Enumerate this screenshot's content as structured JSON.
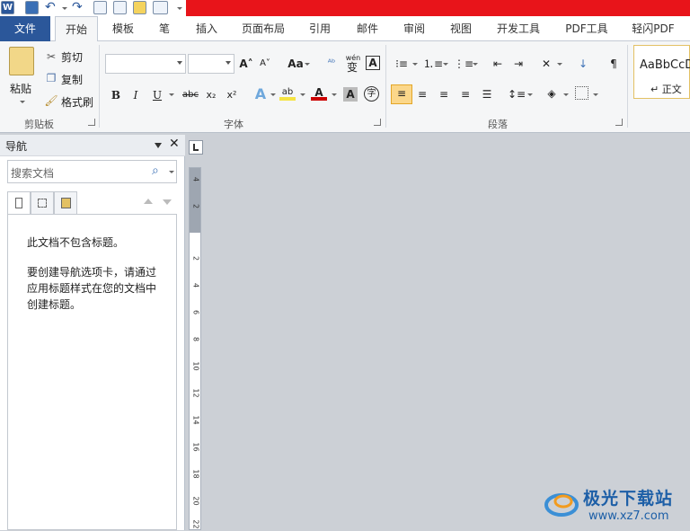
{
  "tabs": [
    "文件",
    "开始",
    "模板",
    "笔",
    "插入",
    "页面布局",
    "引用",
    "邮件",
    "审阅",
    "视图",
    "开发工具",
    "PDF工具",
    "轻闪PDF"
  ],
  "clipboard": {
    "paste": "粘贴",
    "cut": "剪切",
    "copy": "复制",
    "format_painter": "格式刷",
    "group": "剪贴板"
  },
  "font": {
    "group": "字体",
    "aa": "Aa",
    "bold": "B",
    "italic": "I",
    "underline": "U",
    "strike": "abc",
    "sub": "x₂",
    "sup": "x²",
    "wen": "wén",
    "wen_char": "变",
    "a_box": "A",
    "zi": "字"
  },
  "paragraph": {
    "group": "段落"
  },
  "styles": {
    "sample": "AaBbCcD",
    "name": "正文"
  },
  "nav": {
    "title": "导航",
    "search_placeholder": "搜索文档",
    "line1": "此文档不包含标题。",
    "line2": "要创建导航选项卡，请通过",
    "line3": "应用标题样式在您的文档中",
    "line4": "创建标题。"
  },
  "ruler": {
    "numbers": [
      "4",
      "2",
      "2",
      "4",
      "6",
      "8",
      "10",
      "12",
      "14",
      "16",
      "18",
      "20",
      "22"
    ]
  },
  "watermark": {
    "title": "极光下载站",
    "url": "www.xz7.com"
  }
}
